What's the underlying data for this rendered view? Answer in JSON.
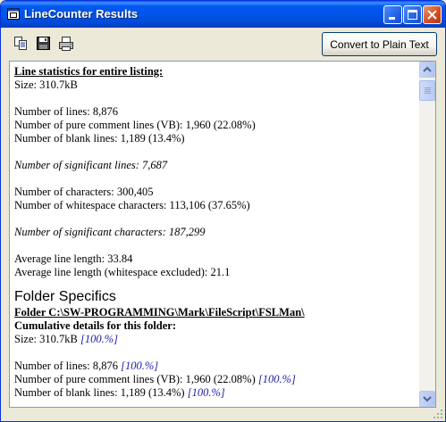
{
  "window": {
    "title": "LineCounter Results"
  },
  "toolbar": {
    "icons": [
      "copy-icon",
      "save-icon",
      "print-icon"
    ],
    "convert_label": "Convert to Plain Text"
  },
  "colors": {
    "titlebar": "#0055e5",
    "percent_text": "#1a1aa6",
    "window_bg": "#ece9d8"
  },
  "report": {
    "header": "Line statistics for entire listing:",
    "size": "Size: 310.7kB",
    "lines": "Number of lines: 8,876",
    "comment_lines": "Number of pure comment lines (VB): 1,960 (22.08%)",
    "blank_lines": "Number of blank lines: 1,189 (13.4%)",
    "significant_lines": "Number of significant lines: 7,687",
    "characters": "Number of characters: 300,405",
    "whitespace_chars": "Number of whitespace characters: 113,106 (37.65%)",
    "significant_chars": "Number of significant characters: 187,299",
    "avg_line": "Average line length: 33.84",
    "avg_line_no_ws": "Average line length (whitespace excluded): 21.1"
  },
  "folder": {
    "heading": "Folder Specifics",
    "path": "Folder C:\\SW-PROGRAMMING\\Mark\\FileScript\\FSLMan\\",
    "cumulative": "Cumulative details for this folder:",
    "size": "Size: 310.7kB",
    "size_pct": "[100.%]",
    "lines": "Number of lines: 8,876",
    "lines_pct": "[100.%]",
    "comment_lines": "Number of pure comment lines (VB): 1,960 (22.08%)",
    "comment_pct": "[100.%]",
    "blank_lines": "Number of blank lines: 1,189 (13.4%)",
    "blank_pct": "[100.%]"
  }
}
